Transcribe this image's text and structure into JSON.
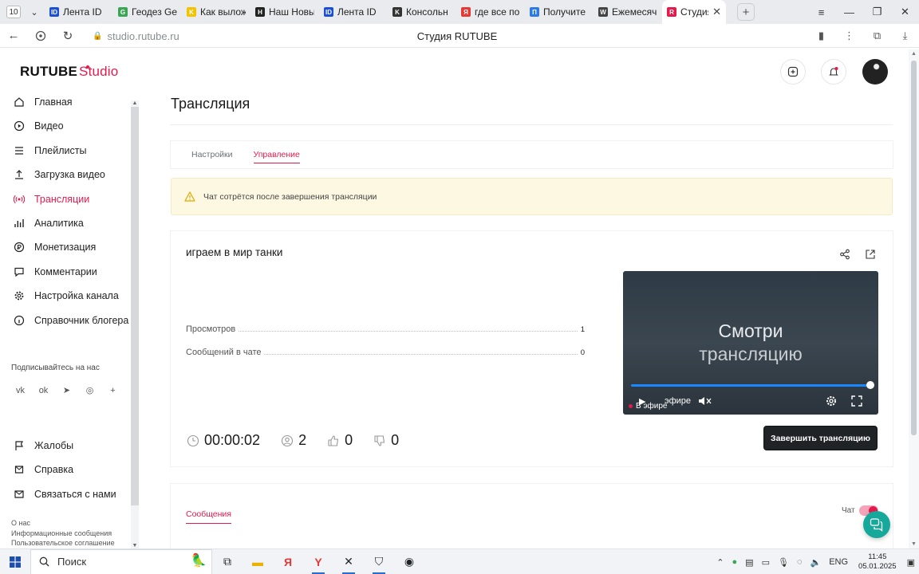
{
  "browser": {
    "tab_counter": "10",
    "tabs": [
      {
        "title": "Лента ID",
        "color": "#1a4fd6",
        "glyph": "ID"
      },
      {
        "title": "Геодез Geo",
        "color": "#3aa655",
        "glyph": "G"
      },
      {
        "title": "Как вылож",
        "color": "#f2c400",
        "glyph": "K"
      },
      {
        "title": "Наш Новый",
        "color": "#222222",
        "glyph": "H"
      },
      {
        "title": "Лента ID",
        "color": "#1a4fd6",
        "glyph": "ID"
      },
      {
        "title": "Консольн",
        "color": "#333333",
        "glyph": "K"
      },
      {
        "title": "где все по",
        "color": "#e53935",
        "glyph": "Я"
      },
      {
        "title": "Получите",
        "color": "#2c7be5",
        "glyph": "П"
      },
      {
        "title": "Ежемесяч",
        "color": "#444444",
        "glyph": "W"
      },
      {
        "title": "Студия",
        "color": "#e6194b",
        "glyph": "R"
      }
    ],
    "url": "studio.rutube.ru",
    "page_title": "Студия RUTUBE"
  },
  "header": {
    "logo_main": "RUTUBE",
    "logo_sub": "Studio"
  },
  "sidebar": {
    "items": [
      {
        "label": "Главная",
        "icon": "home-icon"
      },
      {
        "label": "Видео",
        "icon": "video-icon"
      },
      {
        "label": "Плейлисты",
        "icon": "playlist-icon"
      },
      {
        "label": "Загрузка видео",
        "icon": "upload-icon"
      },
      {
        "label": "Трансляции",
        "icon": "broadcast-icon",
        "active": true
      },
      {
        "label": "Аналитика",
        "icon": "analytics-icon"
      },
      {
        "label": "Монетизация",
        "icon": "monetization-icon"
      },
      {
        "label": "Комментарии",
        "icon": "comments-icon"
      },
      {
        "label": "Настройка канала",
        "icon": "channel-settings-icon"
      },
      {
        "label": "Справочник блогера",
        "icon": "guide-icon"
      }
    ],
    "subscribe_label": "Подписывайтесь на нас",
    "socials": [
      "vk-icon",
      "ok-icon",
      "telegram-icon",
      "viber-icon",
      "more-icon"
    ],
    "bottom_items": [
      {
        "label": "Жалобы",
        "icon": "flag-icon"
      },
      {
        "label": "Справка",
        "icon": "help-icon"
      },
      {
        "label": "Связаться с нами",
        "icon": "mail-icon"
      }
    ],
    "footer_links": [
      "О нас",
      "Информационные сообщения",
      "Пользовательское соглашение"
    ]
  },
  "main": {
    "page_title": "Трансляция",
    "tabs": [
      {
        "label": "Настройки",
        "active": false
      },
      {
        "label": "Управление",
        "active": true
      }
    ],
    "warning": "Чат сотрётся после завершения трансляции",
    "stream": {
      "title": "играем в мир танки",
      "stats": [
        {
          "label": "Просмотров",
          "value": "1"
        },
        {
          "label": "Сообщений в чате",
          "value": "0"
        }
      ],
      "player": {
        "line1": "Смотри",
        "line2": "трансляцию",
        "live_label": "В эфире",
        "ghost_text": "эфире",
        "progress": 1.0
      },
      "duration": "00:00:02",
      "viewers": "2",
      "likes": "0",
      "dislikes": "0",
      "end_button": "Завершить трансляцию"
    },
    "messages": {
      "tab_label": "Сообщения",
      "chat_label": "Чат",
      "chat_enabled": true
    }
  },
  "taskbar": {
    "search_placeholder": "Поиск",
    "lang": "ENG",
    "time": "11:45",
    "date": "05.01.2025"
  },
  "colors": {
    "accent": "#e6194b",
    "warning_bg": "#fdf8e1",
    "support": "#16a89a"
  }
}
